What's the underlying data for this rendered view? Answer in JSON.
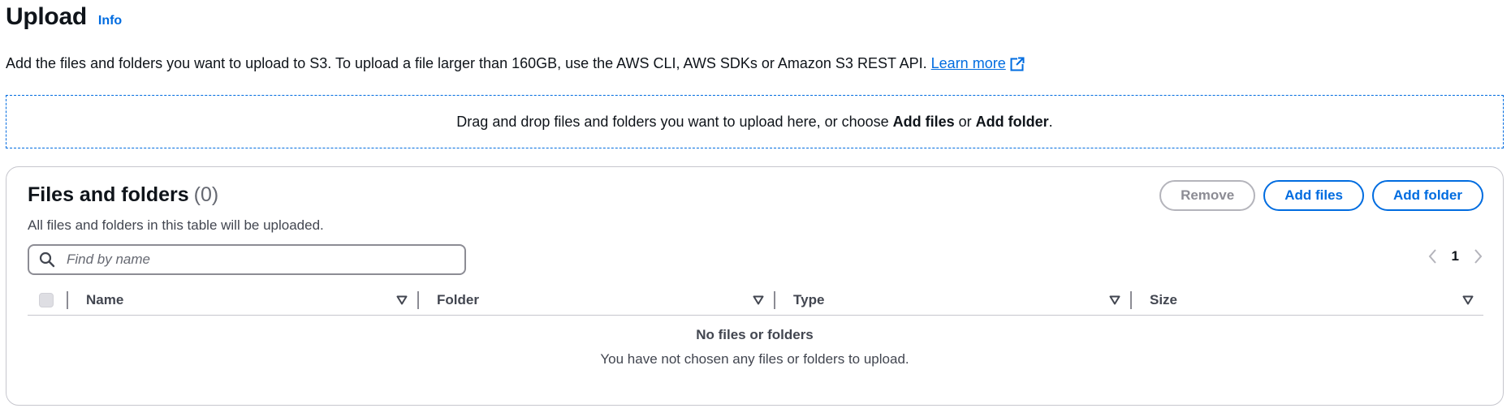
{
  "header": {
    "title": "Upload",
    "info_label": "Info"
  },
  "description": {
    "text": "Add the files and folders you want to upload to S3. To upload a file larger than 160GB, use the AWS CLI, AWS SDKs or Amazon S3 REST API.",
    "learn_more": "Learn more"
  },
  "dropzone": {
    "text_before": "Drag and drop files and folders you want to upload here, or choose ",
    "add_files": "Add files",
    "or": " or ",
    "add_folder": "Add folder",
    "period": "."
  },
  "panel": {
    "title": "Files and folders",
    "count": "(0)",
    "subtitle": "All files and folders in this table will be uploaded.",
    "buttons": {
      "remove": "Remove",
      "add_files": "Add files",
      "add_folder": "Add folder"
    },
    "search": {
      "placeholder": "Find by name",
      "value": ""
    },
    "pagination": {
      "current_page": "1"
    },
    "table": {
      "columns": [
        "Name",
        "Folder",
        "Type",
        "Size"
      ],
      "empty_title": "No files or folders",
      "empty_message": "You have not chosen any files or folders to upload."
    }
  },
  "colors": {
    "link": "#006ce0",
    "text": "#0f141a",
    "muted": "#424650",
    "disabled": "#8c8c94",
    "border": "#c6c6cd"
  },
  "icons": {
    "external": "external-link-icon",
    "search": "search-icon",
    "prev": "chevron-left-icon",
    "next": "chevron-right-icon",
    "sort": "sort-icon"
  }
}
